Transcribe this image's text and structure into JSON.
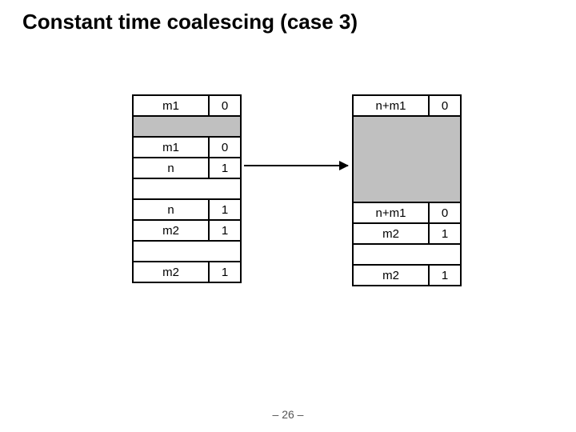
{
  "title": "Constant time coalescing (case 3)",
  "page_num": "– 26 –",
  "left": {
    "r0": {
      "size": "m1",
      "bit": "0"
    },
    "r1": {
      "size": "m1",
      "bit": "0"
    },
    "r2": {
      "size": "n",
      "bit": "1"
    },
    "r3": {
      "size": "n",
      "bit": "1"
    },
    "r4": {
      "size": "m2",
      "bit": "1"
    },
    "r5": {
      "size": "m2",
      "bit": "1"
    }
  },
  "right": {
    "r0": {
      "size": "n+m1",
      "bit": "0"
    },
    "r1": {
      "size": "n+m1",
      "bit": "0"
    },
    "r2": {
      "size": "m2",
      "bit": "1"
    },
    "r3": {
      "size": "m2",
      "bit": "1"
    }
  }
}
